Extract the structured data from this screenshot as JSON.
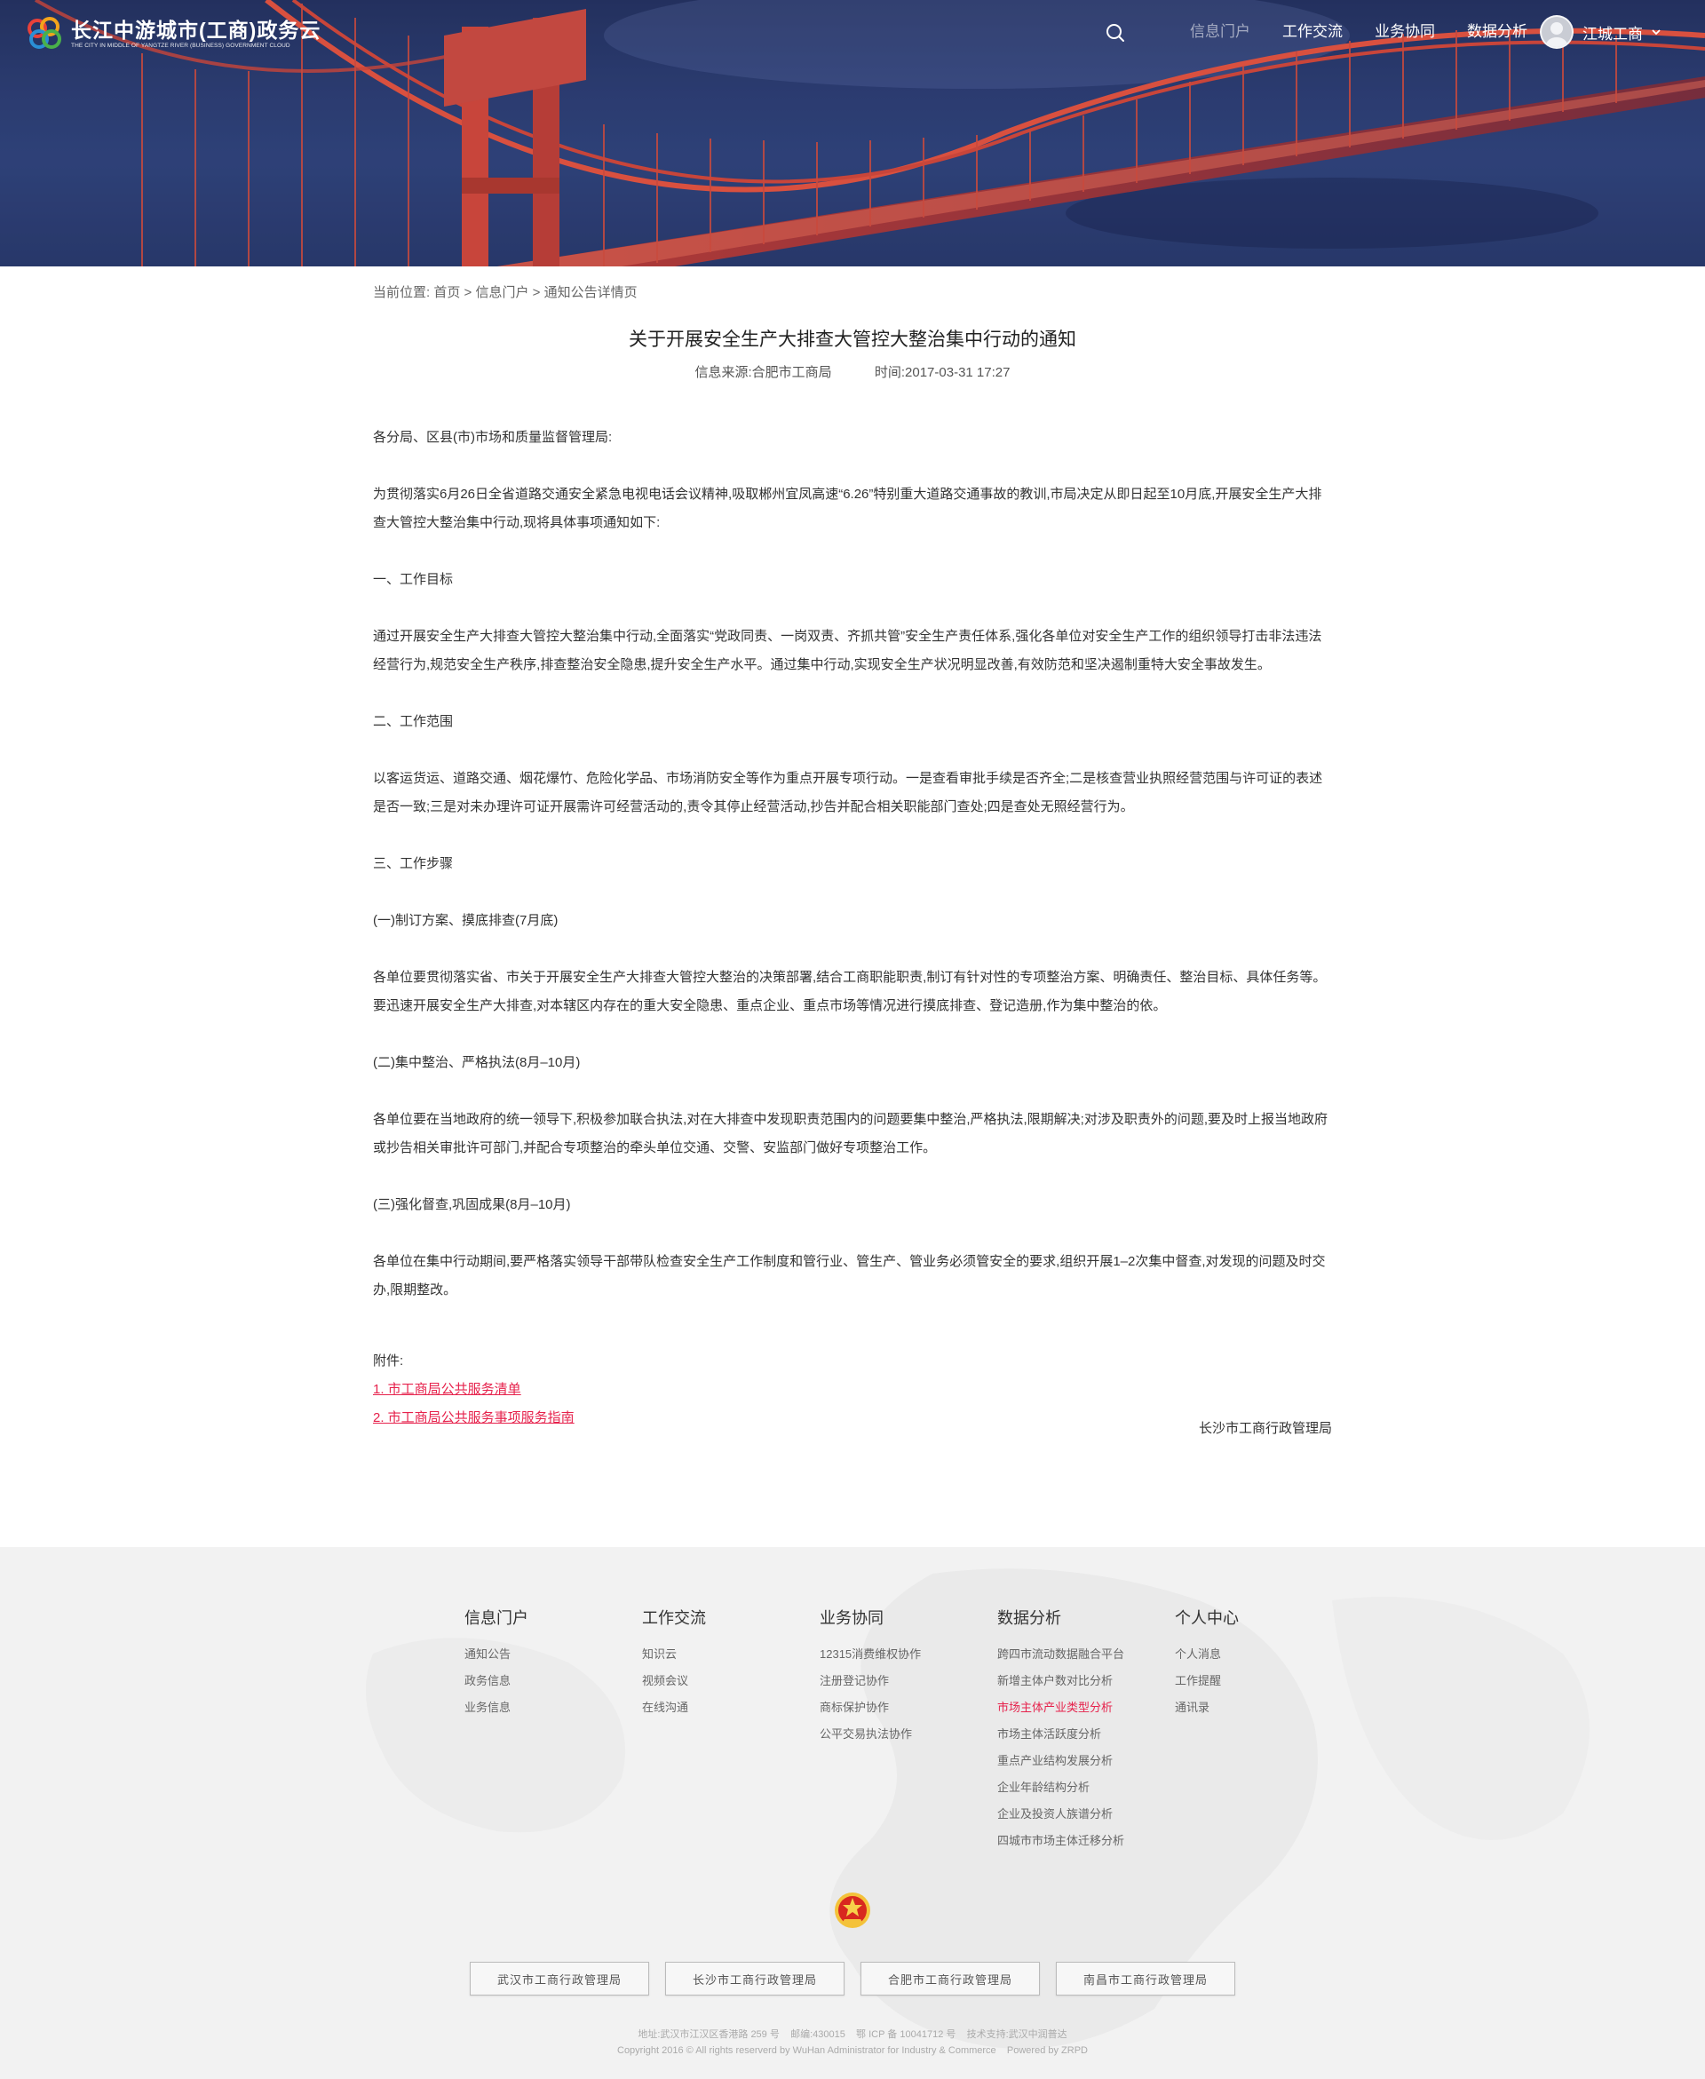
{
  "header": {
    "logo_title": "长江中游城市(工商)政务云",
    "logo_subtitle": "THE CITY IN MIDDLE OF YANGTZE RIVER (BUSINESS) GOVERNMENT CLOUD",
    "nav": [
      "信息门户",
      "工作交流",
      "业务协同",
      "数据分析"
    ],
    "active_nav": "信息门户",
    "user_name": "江城工商"
  },
  "breadcrumb": {
    "prefix": "当前位置:",
    "items": [
      "首页",
      "信息门户",
      "通知公告详情页"
    ],
    "separator": ">"
  },
  "article": {
    "title": "关于开展安全生产大排查大管控大整治集中行动的通知",
    "source": "信息来源:合肥市工商局",
    "time": "时间:2017-03-31 17:27",
    "paragraphs": [
      "各分局、区县(市)市场和质量监督管理局:",
      "为贯彻落实6月26日全省道路交通安全紧急电视电话会议精神,吸取郴州宜凤高速“6.26”特别重大道路交通事故的教训,市局决定从即日起至10月底,开展安全生产大排查大管控大整治集中行动,现将具体事项通知如下:",
      "一、工作目标",
      "通过开展安全生产大排查大管控大整治集中行动,全面落实“党政同责、一岗双责、齐抓共管”安全生产责任体系,强化各单位对安全生产工作的组织领导打击非法违法经营行为,规范安全生产秩序,排查整治安全隐患,提升安全生产水平。通过集中行动,实现安全生产状况明显改善,有效防范和坚决遏制重特大安全事故发生。",
      "二、工作范围",
      "以客运货运、道路交通、烟花爆竹、危险化学品、市场消防安全等作为重点开展专项行动。一是查看审批手续是否齐全;二是核查营业执照经营范围与许可证的表述是否一致;三是对未办理许可证开展需许可经营活动的,责令其停止经营活动,抄告并配合相关职能部门查处;四是查处无照经营行为。",
      "三、工作步骤",
      "(一)制订方案、摸底排查(7月底)",
      "各单位要贯彻落实省、市关于开展安全生产大排查大管控大整治的决策部署,结合工商职能职责,制订有针对性的专项整治方案、明确责任、整治目标、具体任务等。要迅速开展安全生产大排查,对本辖区内存在的重大安全隐患、重点企业、重点市场等情况进行摸底排查、登记造册,作为集中整治的依。",
      "(二)集中整治、严格执法(8月–10月)",
      "各单位要在当地政府的统一领导下,积极参加联合执法,对在大排查中发现职责范围内的问题要集中整治,严格执法,限期解决;对涉及职责外的问题,要及时上报当地政府或抄告相关审批许可部门,并配合专项整治的牵头单位交通、交警、安监部门做好专项整治工作。",
      "(三)强化督查,巩固成果(8月–10月)",
      "各单位在集中行动期间,要严格落实领导干部带队检查安全生产工作制度和管行业、管生产、管业务必须管安全的要求,组织开展1–2次集中督查,对发现的问题及时交办,限期整改。"
    ],
    "attachments_label": "附件:",
    "attachments": [
      "1. 市工商局公共服务清单",
      "2. 市工商局公共服务事项服务指南"
    ],
    "signature": "长沙市工商行政管理局"
  },
  "footer": {
    "columns": [
      {
        "title": "信息门户",
        "links": [
          "通知公告",
          "政务信息",
          "业务信息"
        ]
      },
      {
        "title": "工作交流",
        "links": [
          "知识云",
          "视频会议",
          "在线沟通"
        ]
      },
      {
        "title": "业务协同",
        "links": [
          "12315消费维权协作",
          "注册登记协作",
          "商标保护协作",
          "公平交易执法协作"
        ]
      },
      {
        "title": "数据分析",
        "links": [
          "跨四市流动数据融合平台",
          "新增主体户数对比分析",
          "市场主体产业类型分析",
          "市场主体活跃度分析",
          "重点产业结构发展分析",
          "企业年龄结构分析",
          "企业及投资人族谱分析",
          "四城市市场主体迁移分析"
        ]
      },
      {
        "title": "个人中心",
        "links": [
          "个人消息",
          "工作提醒",
          "通讯录"
        ]
      }
    ],
    "highlighted_link": "市场主体产业类型分析",
    "partners": [
      "武汉市工商行政管理局",
      "长沙市工商行政管理局",
      "合肥市工商行政管理局",
      "南昌市工商行政管理局"
    ],
    "info_line1": "地址:武汉市江汉区香港路 259 号    邮编:430015    鄂 ICP 备 10041712 号    技术支持:武汉中润普达",
    "info_line2": "Copyright 2016 © All rights reserverd by WuHan Administrator for Industry & Commerce    Powered by ZRPD"
  },
  "colors": {
    "accent_red": "#e6224c",
    "hero_blue": "#27376a",
    "bridge_red": "#d8473e",
    "footer_bg": "#f2f2f2"
  },
  "icons": [
    "logo-icon",
    "search-icon",
    "avatar",
    "chevron-down-icon",
    "emblem-icon"
  ]
}
